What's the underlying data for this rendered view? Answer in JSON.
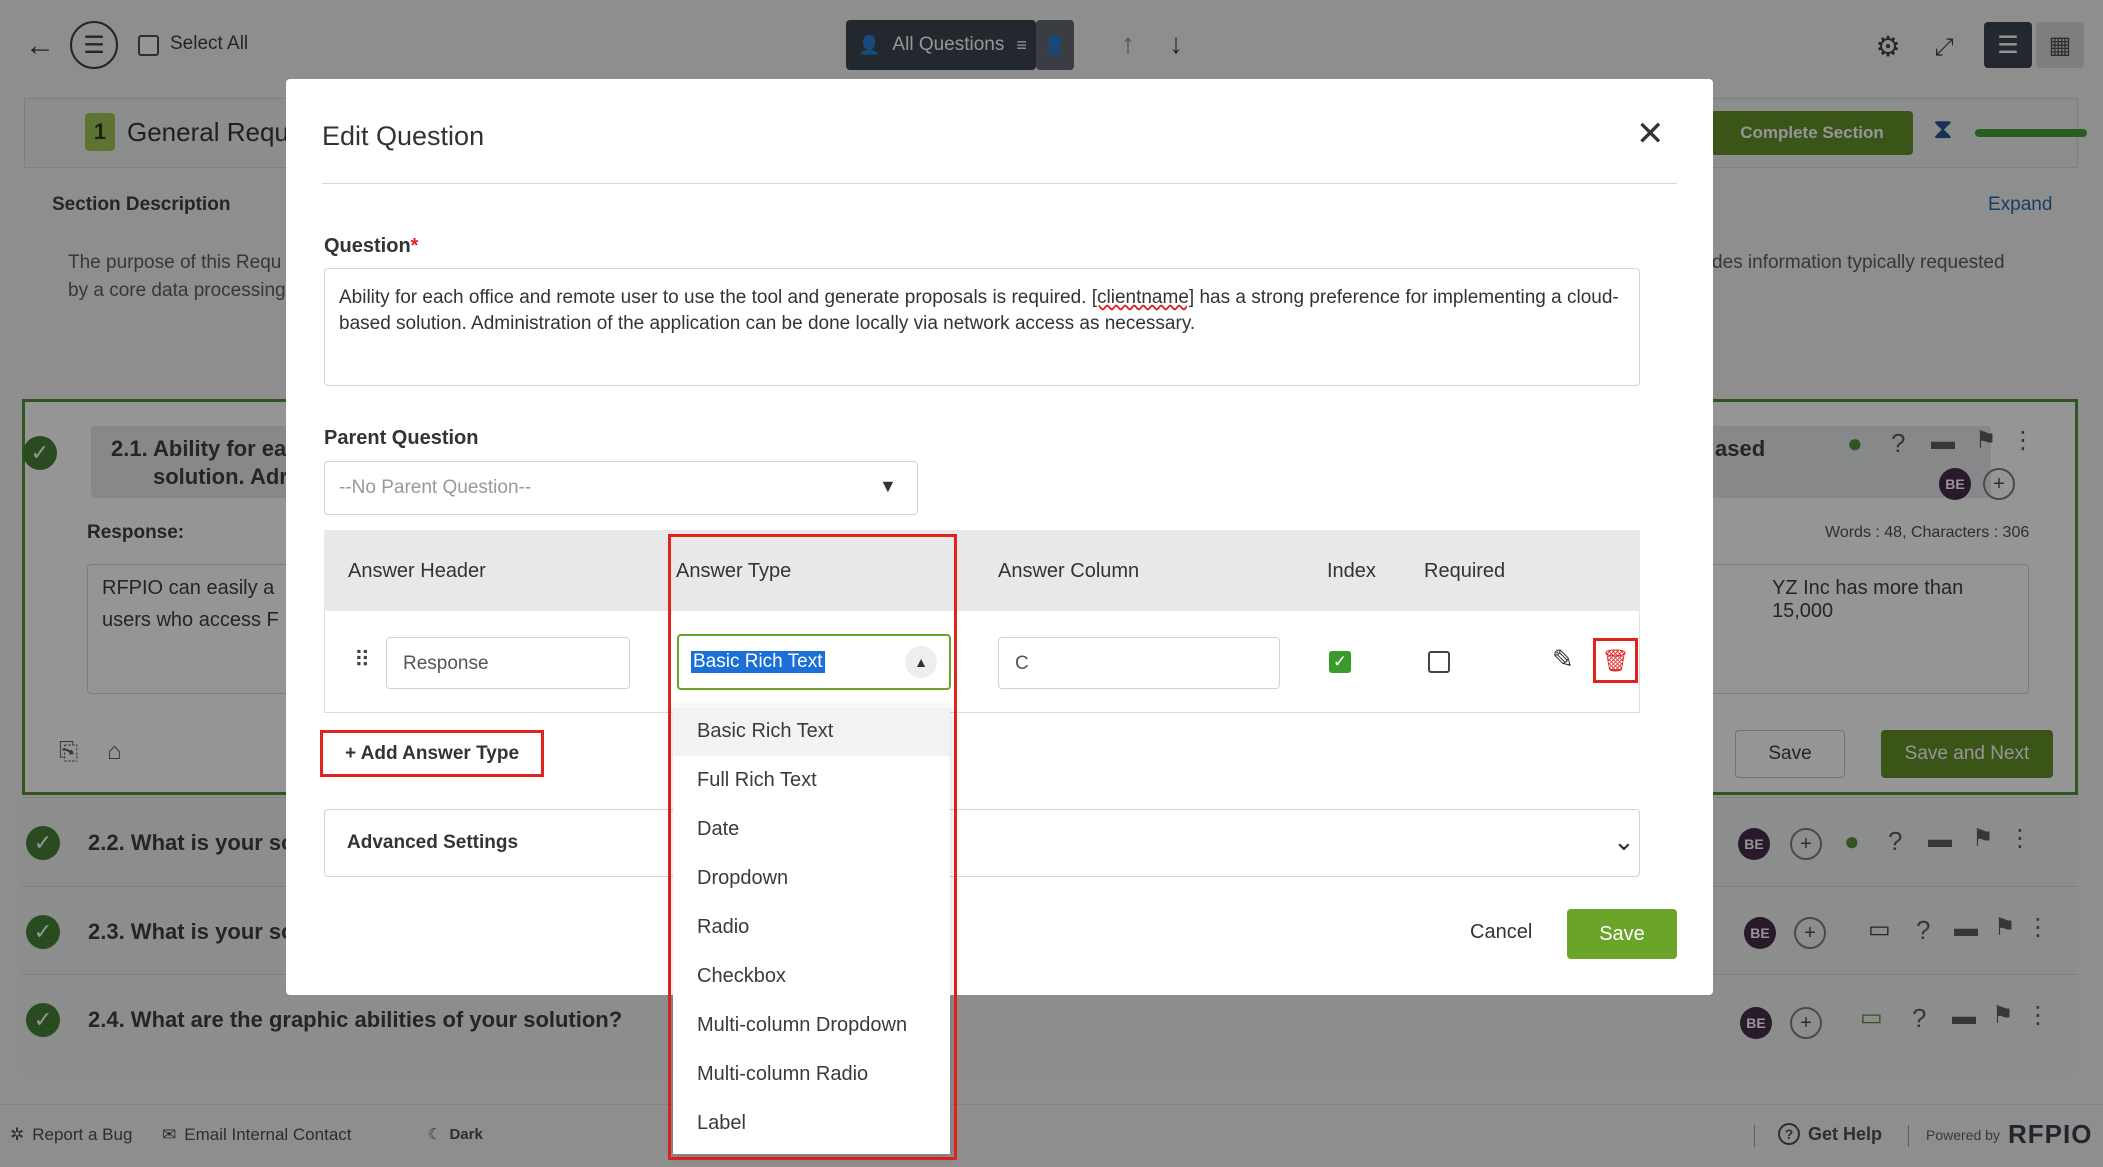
{
  "toolbar": {
    "select_all": "Select All",
    "filter_label": "All Questions"
  },
  "section": {
    "number": "1",
    "title": "General Requi",
    "complete_btn": "Complete Section",
    "description_label": "Section Description",
    "expand_label": "Expand",
    "description_left": "The purpose of this Requ",
    "description_left2": "by a core data processing",
    "description_right": "des information typically requested"
  },
  "question_card": {
    "title_left": "2.1. Ability for eac",
    "title_left2": "solution.  Adr",
    "title_right": "ased",
    "response_label": "Response:",
    "word_count": "Words : 48, Characters : 306",
    "response_left": "RFPIO can easily a",
    "response_left2": "users who access F",
    "response_right": "YZ Inc has more than 15,000",
    "save_btn": "Save",
    "save_next_btn": "Save and Next"
  },
  "question_rows": [
    {
      "label": "2.2. What is your so"
    },
    {
      "label": "2.3. What is your so"
    },
    {
      "label": "2.4. What are the graphic abilities of your solution?"
    }
  ],
  "avatar_initials": "BE",
  "modal": {
    "title": "Edit Question",
    "question_label": "Question",
    "required_mark": "*",
    "question_text_1": "Ability for each office and remote user to use the tool and generate proposals is required.  ",
    "question_token": "[clientname]",
    "question_text_2": " has a strong preference for implementing a cloud-",
    "question_text_3": "based solution.  Administration of the application can be done locally via network access as necessary.",
    "parent_label": "Parent Question",
    "parent_placeholder": "--No Parent Question--",
    "table": {
      "headers": [
        "Answer Header",
        "Answer Type",
        "Answer Column",
        "Index",
        "Required"
      ],
      "row": {
        "header_value": "Response",
        "type_value": "Basic Rich Text",
        "column_value": "C",
        "index_checked": true,
        "required_checked": false
      }
    },
    "add_answer_type": "+ Add Answer Type",
    "advanced_settings": "Advanced Settings",
    "cancel": "Cancel",
    "save": "Save",
    "answer_type_options": [
      "Basic Rich Text",
      "Full Rich Text",
      "Date",
      "Dropdown",
      "Radio",
      "Checkbox",
      "Multi-column Dropdown",
      "Multi-column Radio",
      "Label"
    ]
  },
  "footer": {
    "report_bug": "Report a Bug",
    "email_contact": "Email Internal Contact",
    "dark": "Dark",
    "get_help": "Get Help",
    "powered_by": "Powered by",
    "brand": "RFPIO"
  },
  "colors": {
    "accent_green": "#5b8a1c",
    "save_green": "#6aa52a",
    "highlight_red": "#e0231c",
    "selection_blue": "#1b6fd6"
  }
}
